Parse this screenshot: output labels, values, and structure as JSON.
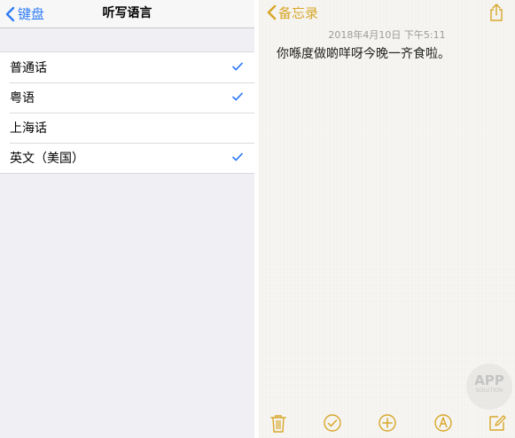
{
  "left_panel": {
    "back_label": "键盘",
    "title": "听写语言",
    "languages": [
      {
        "label": "普通话",
        "checked": true
      },
      {
        "label": "粤语",
        "checked": true
      },
      {
        "label": "上海话",
        "checked": false
      },
      {
        "label": "英文（美国）",
        "checked": true
      }
    ],
    "accent_color": "#2f7cf6"
  },
  "right_panel": {
    "back_label": "备忘录",
    "date": "2018年4月10日 下午5:11",
    "body": "你喺度做啲咩呀今晚一齐食啦。",
    "accent_color": "#d8a72a",
    "icons": {
      "share": "share-icon",
      "delete": "trash-icon",
      "checklist": "checklist-icon",
      "add": "add-icon",
      "markup": "markup-icon",
      "compose": "compose-icon"
    },
    "watermark": {
      "main": "APP",
      "sub": "SOLUTION"
    }
  }
}
